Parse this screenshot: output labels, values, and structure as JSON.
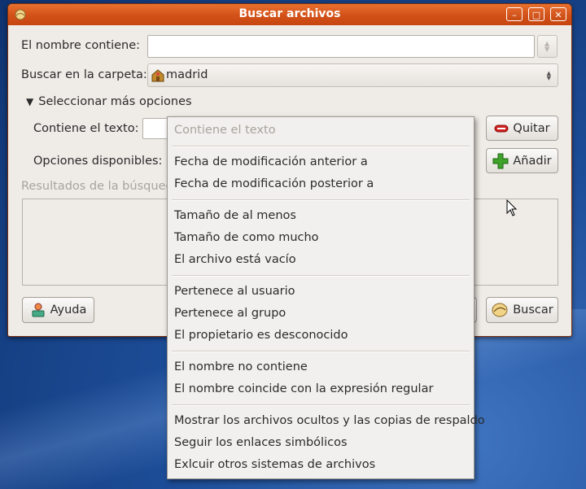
{
  "window": {
    "title": "Buscar archivos"
  },
  "form": {
    "name_label": "El nombre contiene:",
    "name_value": "",
    "folder_label": "Buscar en la carpeta:",
    "folder_value": "madrid",
    "more_options_label": "Seleccionar más opciones",
    "contains_text_label": "Contiene el texto:",
    "available_options_label": "Opciones disponibles:",
    "results_label": "Resultados de la búsqueda"
  },
  "buttons": {
    "remove": "Quitar",
    "add": "Añadir",
    "help": "Ayuda",
    "search": "Buscar"
  },
  "menu": {
    "header": "Contiene el texto",
    "items": [
      "Fecha de modificación anterior a",
      "Fecha de modificación posterior a",
      "Tamaño de al menos",
      "Tamaño de como mucho",
      "El archivo está vacío",
      "Pertenece al usuario",
      "Pertenece al grupo",
      "El propietario es desconocido",
      "El nombre no contiene",
      "El nombre coincide con la expresión regular",
      "Mostrar los archivos ocultos y las copias de respaldo",
      "Seguir los enlaces simbólicos",
      "Exlcuir otros sistemas de archivos"
    ]
  }
}
